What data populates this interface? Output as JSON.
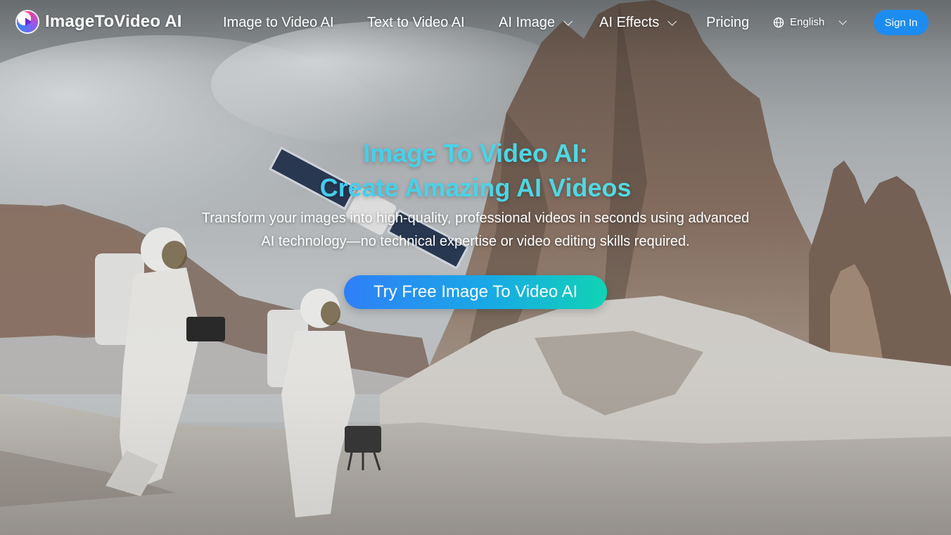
{
  "header": {
    "brand_name": "ImageToVideo AI",
    "nav": [
      {
        "label": "Image to Video AI"
      },
      {
        "label": "Text to Video AI"
      },
      {
        "label": "AI Image"
      },
      {
        "label": "AI Effects"
      },
      {
        "label": "Pricing"
      }
    ],
    "language": "English",
    "sign_in": "Sign In"
  },
  "hero": {
    "title_line1": "Image To Video AI:",
    "title_line2": "Create Amazing AI Videos",
    "subtitle": "Transform your images into high-quality, professional videos in seconds using advanced AI technology—no technical expertise or video editing skills required.",
    "cta": "Try Free Image To Video AI"
  },
  "colors": {
    "accent_blue": "#1d8cf0",
    "cta_gradient_start": "#2f7ff7",
    "cta_gradient_end": "#10d3b4",
    "title_gradient_start": "#38bdf8",
    "title_gradient_end": "#5eead4"
  },
  "icons": {
    "logo": "play-logo-icon",
    "language": "globe-icon",
    "dropdown": "chevron-down-icon"
  }
}
